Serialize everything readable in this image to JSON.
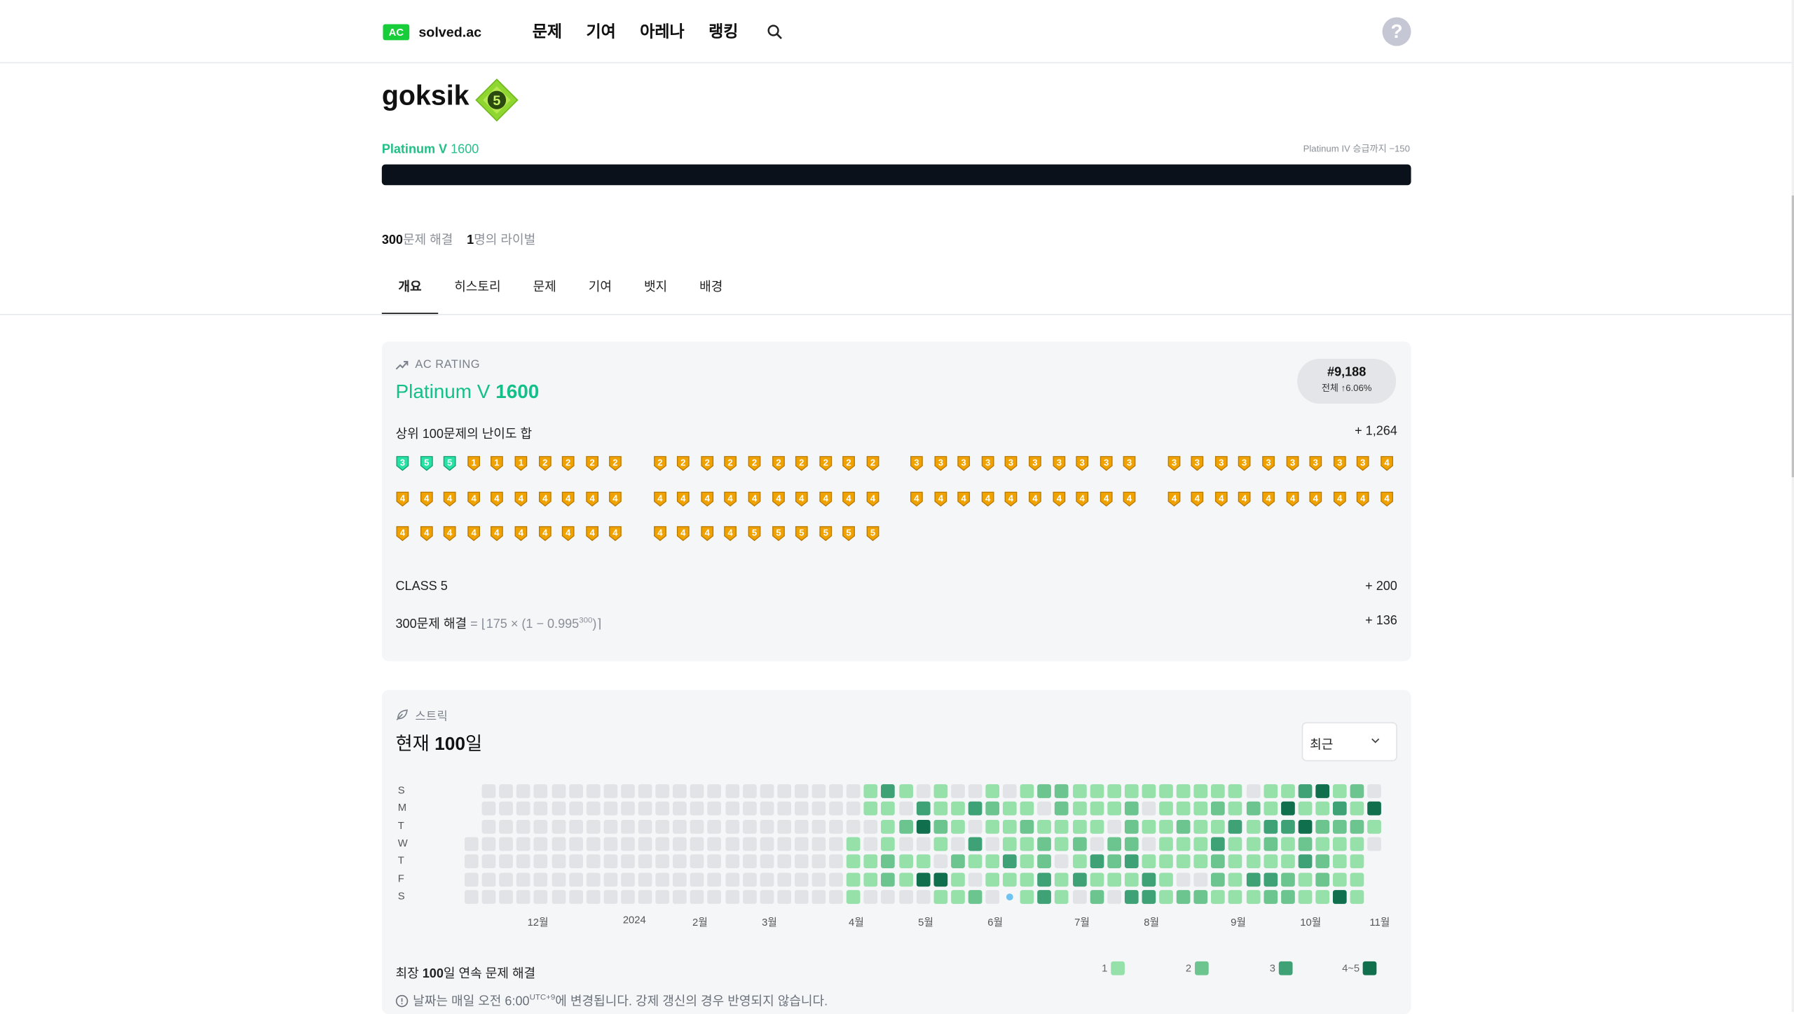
{
  "header": {
    "logo_badge": "AC",
    "logo_text": "solved.ac",
    "nav": [
      "문제",
      "기여",
      "아레나",
      "랭킹"
    ],
    "help_label": "?"
  },
  "profile": {
    "username": "goksik",
    "tier_badge_number": "5",
    "tier_name": "Platinum V",
    "rating": "1600",
    "next_tier_text": "Platinum IV 승급까지 −150",
    "solved_count": "300",
    "solved_label": "문제 해결",
    "rival_count": "1",
    "rival_label": "명의 라이벌"
  },
  "tabs": [
    "개요",
    "히스토리",
    "문제",
    "기여",
    "뱃지",
    "배경"
  ],
  "rating_card": {
    "section_label": "AC RATING",
    "title_tier": "Platinum V",
    "title_rating": "1600",
    "rank": "#9,188",
    "rank_sub": "전체 ↑6.06%",
    "top100_label": "상위 100문제의 난이도 합",
    "top100_value": "+ 1,264",
    "class_label": "CLASS 5",
    "class_value": "+ 200",
    "solved_formula_label": "300문제 해결",
    "solved_formula": "= ⌊175 × (1 − 0.995",
    "solved_formula_exp": "300",
    "solved_formula_end": ")⌉",
    "solved_formula_value": "+ 136",
    "problem_badges": [
      [
        "3g",
        "5g",
        "5g",
        "1o",
        "1o",
        "1o",
        "2o",
        "2o",
        "2o",
        "2o",
        "2o",
        "2o",
        "2o",
        "2o",
        "2o",
        "2o",
        "2o",
        "2o",
        "2o",
        "2o",
        "3o",
        "3o",
        "3o",
        "3o",
        "3o",
        "3o",
        "3o",
        "3o",
        "3o",
        "3o",
        "3o",
        "3o",
        "3o",
        "3o",
        "3o",
        "3o",
        "3o",
        "3o",
        "3o",
        "4o"
      ],
      [
        "4o",
        "4o",
        "4o",
        "4o",
        "4o",
        "4o",
        "4o",
        "4o",
        "4o",
        "4o",
        "4o",
        "4o",
        "4o",
        "4o",
        "4o",
        "4o",
        "4o",
        "4o",
        "4o",
        "4o",
        "4o",
        "4o",
        "4o",
        "4o",
        "4o",
        "4o",
        "4o",
        "4o",
        "4o",
        "4o",
        "4o",
        "4o",
        "4o",
        "4o",
        "4o",
        "4o",
        "4o",
        "4o",
        "4o",
        "4o"
      ],
      [
        "4o",
        "4o",
        "4o",
        "4o",
        "4o",
        "4o",
        "4o",
        "4o",
        "4o",
        "4o",
        "4o",
        "4o",
        "4o",
        "4o",
        "5o",
        "5o",
        "5o",
        "5o",
        "5o",
        "5o"
      ]
    ]
  },
  "streak_card": {
    "section_label": "스트릭",
    "title_prefix": "현재 ",
    "title_value": "100",
    "title_suffix": "일",
    "select_value": "최근",
    "day_labels": [
      "S",
      "M",
      "T",
      "W",
      "T",
      "F",
      "S"
    ],
    "months": [
      "12월",
      "2024",
      "2월",
      "3월",
      "4월",
      "5월",
      "6월",
      "7월",
      "8월",
      "9월",
      "10월",
      "11월"
    ],
    "longest_prefix": "최장 ",
    "longest_value": "100",
    "longest_suffix": "일 연속 문제 해결",
    "legend": [
      "1",
      "2",
      "3",
      "4~5"
    ],
    "note": "날짜는 매일 오전 6:00",
    "note_sup": "UTC+9",
    "note_end": "에 변경됩니다. 강제 갱신의 경우 반영되지 않습니다.",
    "colors": {
      "empty": "#e1e3e7",
      "l1": "#95e1a9",
      "l2": "#6cc58f",
      "l3": "#3ea276",
      "l4": "#10704e",
      "today": "#6fc3f0"
    }
  }
}
